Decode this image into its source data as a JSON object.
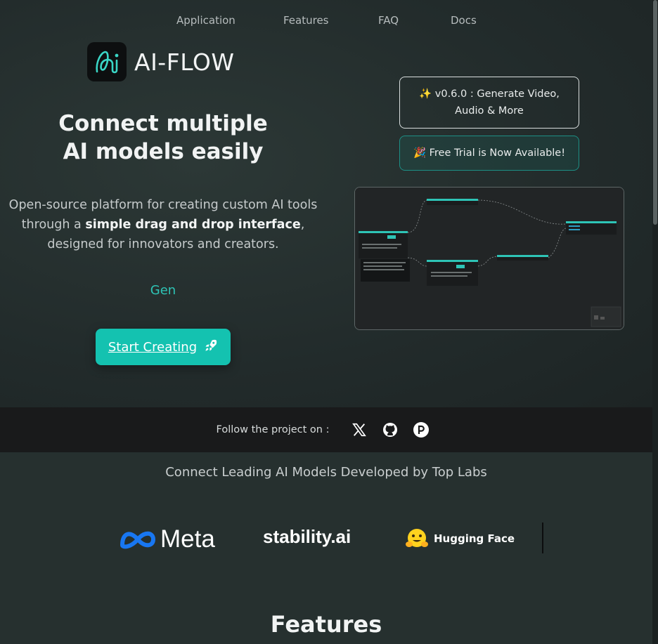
{
  "nav": {
    "items": [
      "Application",
      "Features",
      "FAQ",
      "Docs"
    ]
  },
  "brand": {
    "name": "AI-FLOW",
    "logo_icon": "ai-flow-logo-icon"
  },
  "hero": {
    "headline_line1": "Connect multiple",
    "headline_line2": "AI models easily",
    "subtitle_part1": "Open-source platform for creating custom AI tools through a ",
    "subtitle_bold": "simple drag and drop interface",
    "subtitle_part2": ", designed for innovators and creators.",
    "typed_text": "Gen",
    "cta_label": "Start Creating",
    "cta_icon": "rocket-icon"
  },
  "banners": {
    "version": "✨ v0.6.0 : Generate Video, Audio & More",
    "trial": "🎉 Free Trial is Now Available!"
  },
  "follow": {
    "label": "Follow the project on :",
    "icons": [
      "x-icon",
      "github-icon",
      "patreon-icon"
    ]
  },
  "labs": {
    "title": "Connect Leading AI Models Developed by Top Labs",
    "logos": [
      "Meta",
      "stability.ai",
      "Hugging Face"
    ]
  },
  "features": {
    "title": "Features"
  },
  "colors": {
    "accent": "#14c2b0",
    "accent_text": "#2ec4b6",
    "background": "#222b2b",
    "follow_bar": "#191a1b"
  }
}
